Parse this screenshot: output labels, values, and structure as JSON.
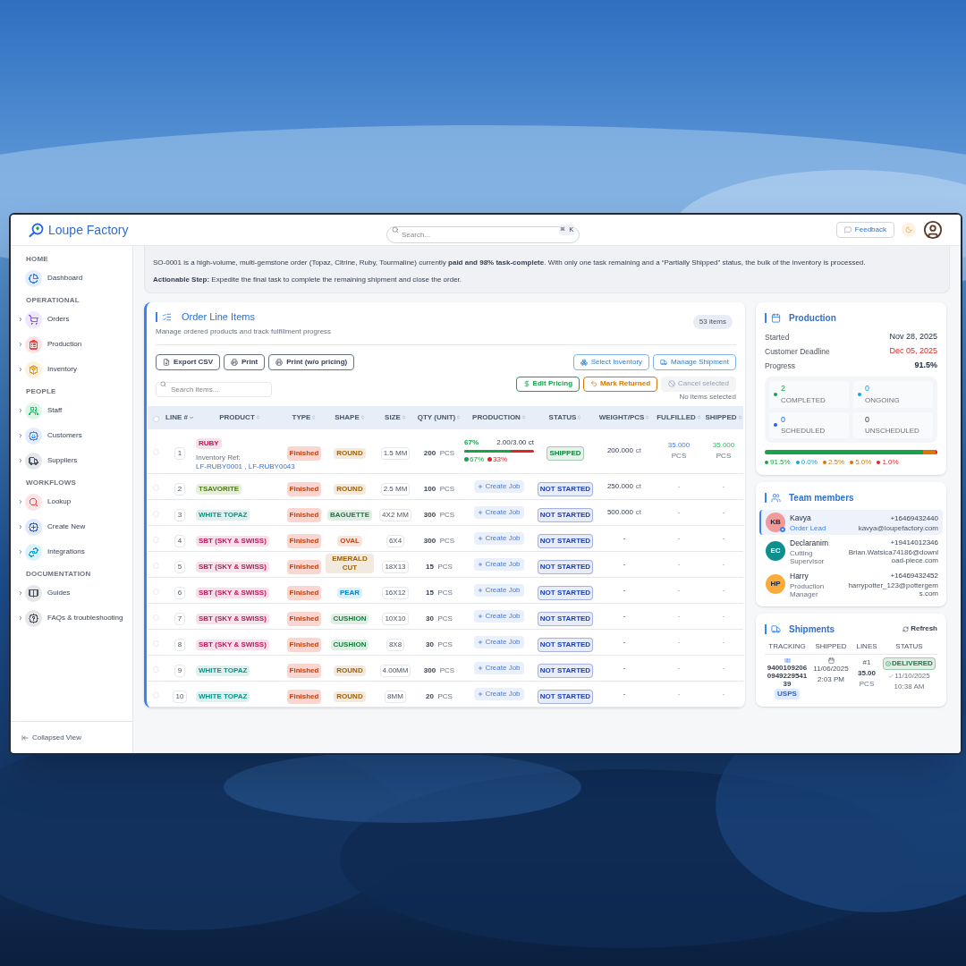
{
  "app": {
    "name": "Loupe Factory"
  },
  "topbar": {
    "search_placeholder": "Search...",
    "shortcut": "⌘ K",
    "feedback": "Feedback"
  },
  "sidebar": {
    "sections": [
      {
        "title": "HOME",
        "items": [
          {
            "label": "Dashboard",
            "color": "#3b82f6",
            "expandable": false
          }
        ]
      },
      {
        "title": "OPERATIONAL",
        "items": [
          {
            "label": "Orders",
            "color": "#8b5cf6",
            "expandable": true
          },
          {
            "label": "Production",
            "color": "#ef4444",
            "expandable": true
          },
          {
            "label": "Inventory",
            "color": "#f59e0b",
            "expandable": true
          }
        ]
      },
      {
        "title": "PEOPLE",
        "items": [
          {
            "label": "Staff",
            "color": "#22c55e",
            "expandable": true
          },
          {
            "label": "Customers",
            "color": "#3b82f6",
            "expandable": true
          },
          {
            "label": "Suppliers",
            "color": "#4b5563",
            "expandable": true
          }
        ]
      },
      {
        "title": "WORKFLOWS",
        "items": [
          {
            "label": "Lookup",
            "color": "#ef4444",
            "expandable": true
          },
          {
            "label": "Create New",
            "color": "#2563eb",
            "expandable": true
          },
          {
            "label": "Integrations",
            "color": "#0ea5e9",
            "expandable": true
          }
        ]
      },
      {
        "title": "DOCUMENTATION",
        "items": [
          {
            "label": "Guides",
            "color": "#4b5563",
            "expandable": true
          },
          {
            "label": "FAQs & troubleshooting",
            "color": "#4b5563",
            "expandable": true
          }
        ]
      }
    ],
    "footer": "Collapsed View"
  },
  "summary": {
    "text": "SO-0001 is a high-volume, multi-gemstone order (Topaz, Citrine, Ruby, Tourmaline) currently **paid and 98% task-complete**. With only one task remaining and a “Partially Shipped” status, the bulk of the inventory is processed.",
    "action": "**Actionable Step:** Expedite the final task to complete the remaining shipment and close the order."
  },
  "line_items": {
    "title": "Order Line Items",
    "subtitle": "Manage ordered products and track fulfillment progress",
    "count": "53 items",
    "export_buttons": [
      "Export CSV",
      "Print",
      "Print (w/o pricing)"
    ],
    "manage_buttons": [
      "Select Inventory",
      "Manage Shipment"
    ],
    "search_placeholder": "Search items...",
    "actions": [
      {
        "label": "Edit Pricing",
        "color": "#16a34a",
        "disabled": false
      },
      {
        "label": "Mark Returned",
        "color": "#d97706",
        "disabled": false
      },
      {
        "label": "Cancel selected",
        "disabled": true
      }
    ],
    "selection_note": "No items selected",
    "table": {
      "select_all": {
        "checked": false
      },
      "columns": [
        {
          "label": "LINE #",
          "sorted": true
        },
        {
          "label": "PRODUCT",
          "sorted": false
        },
        {
          "label": "TYPE",
          "sorted": false
        },
        {
          "label": "SHAPE",
          "sorted": false
        },
        {
          "label": "SIZE",
          "sorted": false
        },
        {
          "label": "QTY (UNIT)",
          "sorted": false
        },
        {
          "label": "PRODUCTION",
          "sorted": false
        },
        {
          "label": "STATUS",
          "sorted": false
        },
        {
          "label": "WEIGHT/PCS",
          "sorted": false
        },
        {
          "label": "FULFILLED",
          "sorted": false
        },
        {
          "label": "SHIPPED",
          "sorted": false
        }
      ],
      "rows": [
        {
          "checked": false,
          "line": "1",
          "product": {
            "label": "RUBY",
            "color": "#be185d"
          },
          "ref_label": "Inventory Ref:",
          "refs": [
            "LF-RUBY0001",
            ", LF-RUBY0043"
          ],
          "type": "Finished",
          "shape": {
            "label": "ROUND",
            "color": "#a16207"
          },
          "size": "1.5 MM",
          "qty": "200",
          "unit": "PCS",
          "production": {
            "kind": "progress",
            "percent": "67%",
            "amount": "2.00/3.00 ct",
            "level": 0.67,
            "legend": [
              {
                "label": "67%",
                "color": "#16a34a"
              },
              {
                "label": "33%",
                "color": "#dc2626"
              }
            ]
          },
          "status": {
            "label": "SHIPPED",
            "color": "#15803d"
          },
          "weight": "200.000",
          "weight_unit": "ct",
          "fulfilled": "35.000",
          "fulfilled_unit": "PCS",
          "shipped": "35.000",
          "shipped_unit": "PCS"
        },
        {
          "checked": false,
          "line": "2",
          "product": {
            "label": "TSAVORITE",
            "color": "#4d7c0f"
          },
          "type": "Finished",
          "shape": {
            "label": "ROUND",
            "color": "#a16207"
          },
          "size": "2.5 MM",
          "qty": "100",
          "unit": "PCS",
          "production": {
            "kind": "button",
            "label": "Create Job"
          },
          "status": {
            "label": "NOT STARTED",
            "color": "#1e40af"
          },
          "weight": "250.000",
          "weight_unit": "ct",
          "fulfilled": "-",
          "shipped": "-"
        },
        {
          "checked": false,
          "line": "3",
          "product": {
            "label": "WHITE TOPAZ",
            "color": "#0d9488"
          },
          "type": "Finished",
          "shape": {
            "label": "BAGUETTE",
            "color": "#15803d"
          },
          "size": "4X2 MM",
          "qty": "300",
          "unit": "PCS",
          "production": {
            "kind": "button",
            "label": "Create Job"
          },
          "status": {
            "label": "NOT STARTED",
            "color": "#1e40af"
          },
          "weight": "500.000",
          "weight_unit": "ct",
          "fulfilled": "-",
          "shipped": "-"
        },
        {
          "checked": false,
          "line": "4",
          "product": {
            "label": "SBT (SKY & SWISS)",
            "color": "#be185d"
          },
          "type": "Finished",
          "shape": {
            "label": "OVAL",
            "color": "#c2410c"
          },
          "size": "6X4",
          "qty": "300",
          "unit": "PCS",
          "production": {
            "kind": "button",
            "label": "Create Job"
          },
          "status": {
            "label": "NOT STARTED",
            "color": "#1e40af"
          },
          "weight": "-",
          "fulfilled": "-",
          "shipped": "-"
        },
        {
          "checked": false,
          "line": "5",
          "product": {
            "label": "SBT (SKY & SWISS)",
            "color": "#be185d"
          },
          "type": "Finished",
          "shape": {
            "label": "EMERALD CUT",
            "color": "#a16207"
          },
          "size": "18X13",
          "qty": "15",
          "unit": "PCS",
          "production": {
            "kind": "button",
            "label": "Create Job"
          },
          "status": {
            "label": "NOT STARTED",
            "color": "#1e40af"
          },
          "weight": "-",
          "fulfilled": "-",
          "shipped": "-"
        },
        {
          "checked": false,
          "line": "6",
          "product": {
            "label": "SBT (SKY & SWISS)",
            "color": "#be185d"
          },
          "type": "Finished",
          "shape": {
            "label": "PEAR",
            "color": "#0284c7"
          },
          "size": "16X12",
          "qty": "15",
          "unit": "PCS",
          "production": {
            "kind": "button",
            "label": "Create Job"
          },
          "status": {
            "label": "NOT STARTED",
            "color": "#1e40af"
          },
          "weight": "-",
          "fulfilled": "-",
          "shipped": "-"
        },
        {
          "checked": false,
          "line": "7",
          "product": {
            "label": "SBT (SKY & SWISS)",
            "color": "#be185d"
          },
          "type": "Finished",
          "shape": {
            "label": "CUSHION",
            "color": "#15803d"
          },
          "size": "10X10",
          "qty": "30",
          "unit": "PCS",
          "production": {
            "kind": "button",
            "label": "Create Job"
          },
          "status": {
            "label": "NOT STARTED",
            "color": "#1e40af"
          },
          "weight": "-",
          "fulfilled": "-",
          "shipped": "-"
        },
        {
          "checked": false,
          "line": "8",
          "product": {
            "label": "SBT (SKY & SWISS)",
            "color": "#be185d"
          },
          "type": "Finished",
          "shape": {
            "label": "CUSHION",
            "color": "#15803d"
          },
          "size": "8X8",
          "qty": "30",
          "unit": "PCS",
          "production": {
            "kind": "button",
            "label": "Create Job"
          },
          "status": {
            "label": "NOT STARTED",
            "color": "#1e40af"
          },
          "weight": "-",
          "fulfilled": "-",
          "shipped": "-"
        },
        {
          "checked": false,
          "line": "9",
          "product": {
            "label": "WHITE TOPAZ",
            "color": "#0d9488"
          },
          "type": "Finished",
          "shape": {
            "label": "ROUND",
            "color": "#a16207"
          },
          "size": "4.00MM",
          "qty": "300",
          "unit": "PCS",
          "production": {
            "kind": "button",
            "label": "Create Job"
          },
          "status": {
            "label": "NOT STARTED",
            "color": "#1e40af"
          },
          "weight": "-",
          "fulfilled": "-",
          "shipped": "-"
        },
        {
          "checked": false,
          "line": "10",
          "product": {
            "label": "WHITE TOPAZ",
            "color": "#0d9488"
          },
          "type": "Finished",
          "shape": {
            "label": "ROUND",
            "color": "#a16207"
          },
          "size": "8MM",
          "qty": "20",
          "unit": "PCS",
          "production": {
            "kind": "button",
            "label": "Create Job"
          },
          "status": {
            "label": "NOT STARTED",
            "color": "#1e40af"
          },
          "weight": "-",
          "fulfilled": "-",
          "shipped": "-"
        }
      ]
    }
  },
  "production": {
    "title": "Production",
    "rows": [
      {
        "label": "Started",
        "value": "Nov 28, 2025",
        "alert": false
      },
      {
        "label": "Customer Deadline",
        "value": "Dec 05, 2025",
        "alert": true
      },
      {
        "label": "Progress",
        "value": "91.5%",
        "alert": false
      }
    ],
    "stats": [
      {
        "value": "2",
        "label": "COMPLETED",
        "color": "#16a34a"
      },
      {
        "value": "0",
        "label": "ONGOING",
        "color": "#0ea5e9"
      },
      {
        "value": "0",
        "label": "SCHEDULED",
        "color": "#2563eb"
      },
      {
        "value": "0",
        "label": "UNSCHEDULED"
      }
    ],
    "segments": [
      {
        "label": "91.5%",
        "color": "#16a34a",
        "level": 0.915
      },
      {
        "label": "0.0%",
        "color": "#0ea5e9"
      },
      {
        "label": "2.5%",
        "color": "#d97706",
        "level": 0.025
      },
      {
        "label": "5.0%",
        "color": "#d97706",
        "level": 0.05
      },
      {
        "label": "1.0%",
        "color": "#dc2626",
        "level": 0.01
      }
    ]
  },
  "team": {
    "title": "Team members",
    "members": [
      {
        "initials": "KB",
        "name": "Kavya",
        "role": "Order Lead",
        "phone": "+16469432440",
        "email": "kavya@loupefactory.com",
        "color": "#f19a9a",
        "selected": true,
        "lead": true
      },
      {
        "initials": "EC",
        "name": "Declaranim",
        "role": "Cutting Supervisor",
        "phone": "+19414012346",
        "email": "Brian.Watsica74186@download-piece.com",
        "color": "#0f8f8f",
        "selected": false,
        "lead": false
      },
      {
        "initials": "HP",
        "name": "Harry",
        "role": "Production Manager",
        "phone": "+16469432452",
        "email": "harrypotter_123@pottergems.com",
        "color": "#fbab3c",
        "selected": false,
        "lead": false
      }
    ]
  },
  "shipments": {
    "title": "Shipments",
    "refresh": "Refresh",
    "columns": [
      "TRACKING",
      "SHIPPED",
      "LINES",
      "STATUS"
    ],
    "rows": [
      {
        "tracking": "9400109206094922954139",
        "carrier": "USPS",
        "date": "11/06/2025",
        "time": "2:03 PM",
        "line": "#1",
        "quantity": "35.00",
        "unit": "PCS",
        "status": {
          "label": "DELIVERED",
          "color": "#15803d"
        },
        "delivered_date": "11/10/2025",
        "delivered_time": "10:38 AM"
      }
    ]
  }
}
